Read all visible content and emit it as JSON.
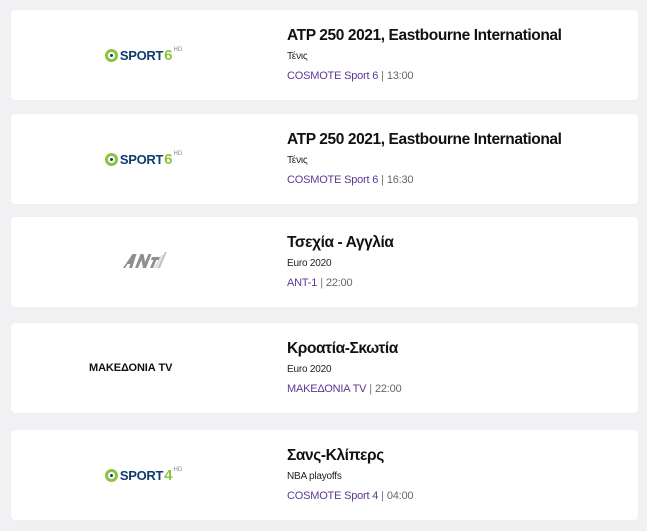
{
  "programs": [
    {
      "logo": {
        "kind": "sport",
        "word": "SPORT",
        "number": "6",
        "badge": "HD",
        "icon": "sport-ball-icon"
      },
      "title": "ATP 250 2021, Eastbourne International",
      "category": "Τένις",
      "channel": "COSMOTE Sport 6",
      "separator": "|",
      "time": "13:00"
    },
    {
      "logo": {
        "kind": "sport",
        "word": "SPORT",
        "number": "6",
        "badge": "HD",
        "icon": "sport-ball-icon"
      },
      "title": "ATP 250 2021, Eastbourne International",
      "category": "Τένις",
      "channel": "COSMOTE Sport 6",
      "separator": "|",
      "time": "16:30"
    },
    {
      "logo": {
        "kind": "ant1"
      },
      "title": "Τσεχία - Αγγλία",
      "category": "Euro 2020",
      "channel": "ANT-1",
      "separator": "|",
      "time": "22:00"
    },
    {
      "logo": {
        "kind": "text",
        "text": "ΜΑΚΕΔΟΝΙΑ TV"
      },
      "title": "Κροατία-Σκωτία",
      "category": "Euro 2020",
      "channel": "ΜΑΚΕΔΟΝΙΑ TV",
      "separator": "|",
      "time": "22:00"
    },
    {
      "logo": {
        "kind": "sport",
        "word": "SPORT",
        "number": "4",
        "badge": "HD",
        "icon": "sport-ball-icon"
      },
      "title": "Σανς-Κλίπερς",
      "category": "NBA playoffs",
      "channel": "COSMOTE Sport 4",
      "separator": "|",
      "time": "04:00"
    }
  ],
  "colors": {
    "page_background": "#f1f1f3",
    "card_background": "#ffffff",
    "channel_link": "#5b3a93",
    "sport_green": "#8bc53f",
    "sport_blue": "#0f3d6e"
  }
}
